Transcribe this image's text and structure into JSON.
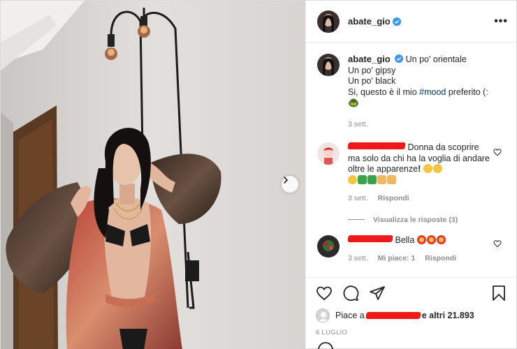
{
  "post": {
    "username": "abate_gio",
    "verified": true,
    "more_label": "•••",
    "caption_lines": [
      "Un po' orientale",
      "Un po' gipsy",
      "Un po' black"
    ],
    "caption_last_prefix": "Si, questo è il mio ",
    "caption_hashtag": "#mood",
    "caption_last_suffix": " preferito (:",
    "caption_time": "3 sett."
  },
  "comments": [
    {
      "text": "Donna da scoprire ma solo da chi ha la voglia di andare oltre le apparenze",
      "time": "3 sett.",
      "reply_label": "Rispondi",
      "view_replies": "Visualizza le risposte (3)"
    },
    {
      "text": "Bella",
      "time": "3 sett.",
      "likes_label": "Mi piace: 1",
      "reply_label": "Rispondi"
    }
  ],
  "likes": {
    "prefix": "Piace a ",
    "suffix": "e altri 21.893"
  },
  "date": "6 LUGLIO",
  "colors": {
    "verified": "#3897f0",
    "redaction": "#e00000",
    "hashtag": "#00376b",
    "meta": "#8e8e8e"
  },
  "icons": [
    "verified-badge-icon",
    "more-options-icon",
    "next-arrow-icon",
    "heart-icon",
    "comment-icon",
    "share-icon",
    "bookmark-icon"
  ]
}
